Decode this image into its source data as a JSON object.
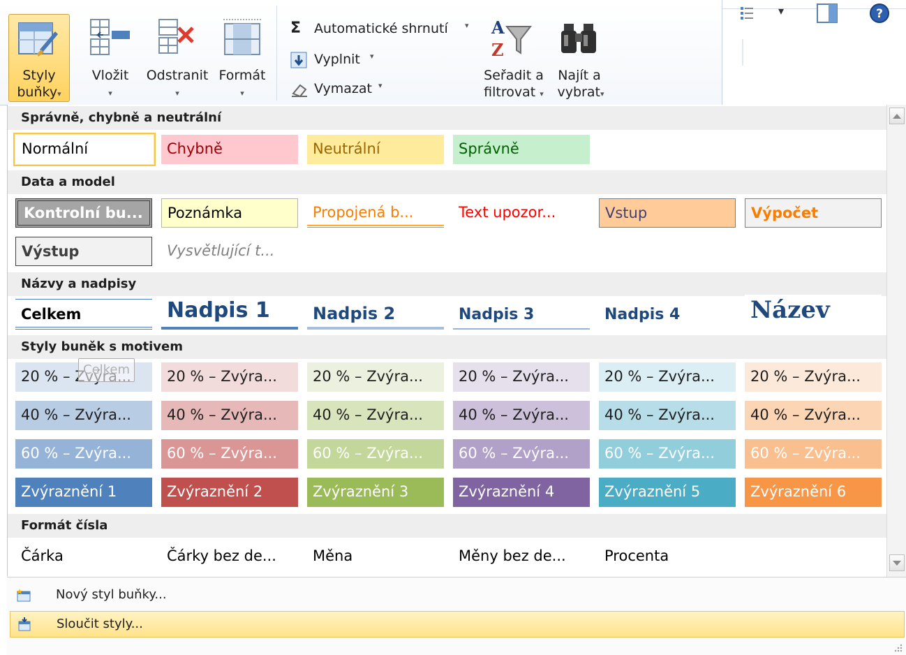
{
  "ribbon": {
    "styles_button": {
      "line1": "Styly",
      "line2": "buňky"
    },
    "insert": "Vložit",
    "delete": "Odstranit",
    "format": "Formát",
    "autosum": "Automatické shrnutí",
    "sigma": "Σ",
    "fill": "Vyplnit",
    "clear": "Vymazat",
    "sort": {
      "line1": "Seřadit a",
      "line2": "filtrovat"
    },
    "find": {
      "line1": "Najít a",
      "line2": "vybrat"
    },
    "dropdown_arrow": "▾"
  },
  "gallery": {
    "sections": {
      "good_bad": "Správně, chybně a neutrální",
      "data_model": "Data a model",
      "titles": "Názvy a nadpisy",
      "themed": "Styly buněk s motivem",
      "number": "Formát čísla"
    },
    "good_bad": [
      "Normální",
      "Chybně",
      "Neutrální",
      "Správně"
    ],
    "data_model": [
      "Kontrolní bu...",
      "Poznámka",
      "Propojená b...",
      "Text upozor...",
      "Vstup",
      "Výpočet",
      "Výstup",
      "Vysvětlující t..."
    ],
    "titles": [
      "Celkem",
      "Nadpis 1",
      "Nadpis 2",
      "Nadpis 3",
      "Nadpis 4",
      "Název"
    ],
    "themed": {
      "r20": [
        "20 % – Zvýra...",
        "20 % – Zvýra...",
        "20 % – Zvýra...",
        "20 % – Zvýra...",
        "20 % – Zvýra...",
        "20 % – Zvýra..."
      ],
      "r40": [
        "40 % – Zvýra...",
        "40 % – Zvýra...",
        "40 % – Zvýra...",
        "40 % – Zvýra...",
        "40 % – Zvýra...",
        "40 % – Zvýra..."
      ],
      "r60": [
        "60 % – Zvýra...",
        "60 % – Zvýra...",
        "60 % – Zvýra...",
        "60 % – Zvýra...",
        "60 % – Zvýra...",
        "60 % – Zvýra..."
      ],
      "accent": [
        "Zvýraznění 1",
        "Zvýraznění 2",
        "Zvýraznění 3",
        "Zvýraznění 4",
        "Zvýraznění 5",
        "Zvýraznění 6"
      ]
    },
    "number": [
      "Čárka",
      "Čárky bez de...",
      "Měna",
      "Měny bez de...",
      "Procenta"
    ],
    "tooltip": "Celkem"
  },
  "menu": {
    "new_style": "Nový styl buňky...",
    "merge_styles": "Sloučit styly..."
  },
  "colors": {
    "accent1": "#4f81bd",
    "accent2": "#c0504d",
    "accent3": "#9bbb59",
    "accent4": "#8064a2",
    "accent5": "#4bacc6",
    "accent6": "#f79646",
    "highlight": "#ffe38a"
  }
}
